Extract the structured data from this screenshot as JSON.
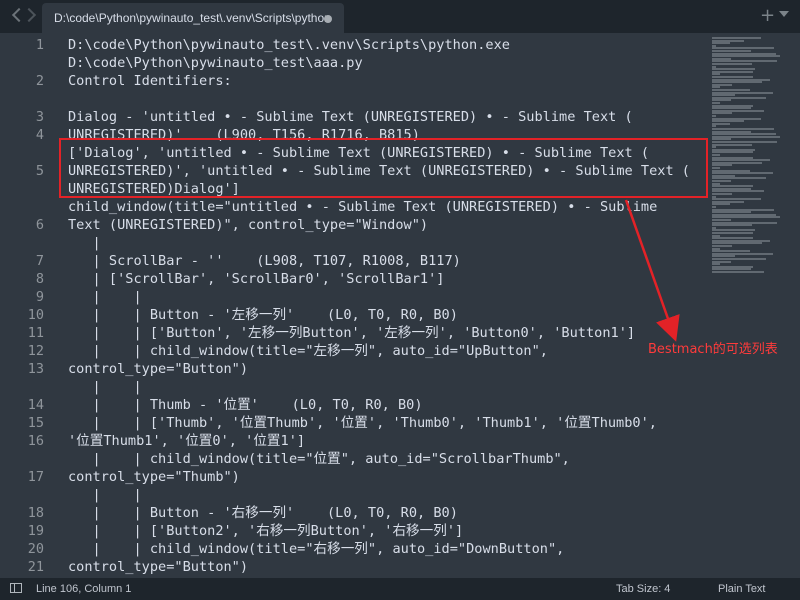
{
  "tab": {
    "title": "D:\\code\\Python\\pywinauto_test\\.venv\\Scripts\\python"
  },
  "gutter": [
    "1",
    "",
    "2",
    "",
    "3",
    "4",
    "",
    "5",
    "",
    "",
    "6",
    "",
    "7",
    "8",
    "9",
    "10",
    "11",
    "12",
    "13",
    "",
    "14",
    "15",
    "16",
    "",
    "17",
    "",
    "18",
    "19",
    "20",
    "21",
    ""
  ],
  "code_lines": [
    "D:\\code\\Python\\pywinauto_test\\.venv\\Scripts\\python.exe",
    "D:\\code\\Python\\pywinauto_test\\aaa.py",
    "Control Identifiers:",
    "",
    "Dialog - 'untitled • - Sublime Text (UNREGISTERED) • - Sublime Text (",
    "UNREGISTERED)'    (L900, T156, R1716, B815)",
    "['Dialog', 'untitled • - Sublime Text (UNREGISTERED) • - Sublime Text (",
    "UNREGISTERED)', 'untitled • - Sublime Text (UNREGISTERED) • - Sublime Text (",
    "UNREGISTERED)Dialog']",
    "child_window(title=\"untitled • - Sublime Text (UNREGISTERED) • - Sublime",
    "Text (UNREGISTERED)\", control_type=\"Window\")",
    "   |",
    "   | ScrollBar - ''    (L908, T107, R1008, B117)",
    "   | ['ScrollBar', 'ScrollBar0', 'ScrollBar1']",
    "   |    |",
    "   |    | Button - '左移一列'    (L0, T0, R0, B0)",
    "   |    | ['Button', '左移一列Button', '左移一列', 'Button0', 'Button1']",
    "   |    | child_window(title=\"左移一列\", auto_id=\"UpButton\",",
    "control_type=\"Button\")",
    "   |    |",
    "   |    | Thumb - '位置'    (L0, T0, R0, B0)",
    "   |    | ['Thumb', '位置Thumb', '位置', 'Thumb0', 'Thumb1', '位置Thumb0',",
    "'位置Thumb1', '位置0', '位置1']",
    "   |    | child_window(title=\"位置\", auto_id=\"ScrollbarThumb\",",
    "control_type=\"Thumb\")",
    "   |    |",
    "   |    | Button - '右移一列'    (L0, T0, R0, B0)",
    "   |    | ['Button2', '右移一列Button', '右移一列']",
    "   |    | child_window(title=\"右移一列\", auto_id=\"DownButton\",",
    "control_type=\"Button\")",
    "   |"
  ],
  "annotation": {
    "label": "Bestmach的可选列表",
    "color": "#e32227"
  },
  "status": {
    "position": "Line 106, Column 1",
    "tab_size": "Tab Size: 4",
    "syntax": "Plain Text"
  },
  "colors": {
    "editor_bg": "#303841",
    "chrome_bg": "#1e252c",
    "text": "#d8dee9"
  }
}
